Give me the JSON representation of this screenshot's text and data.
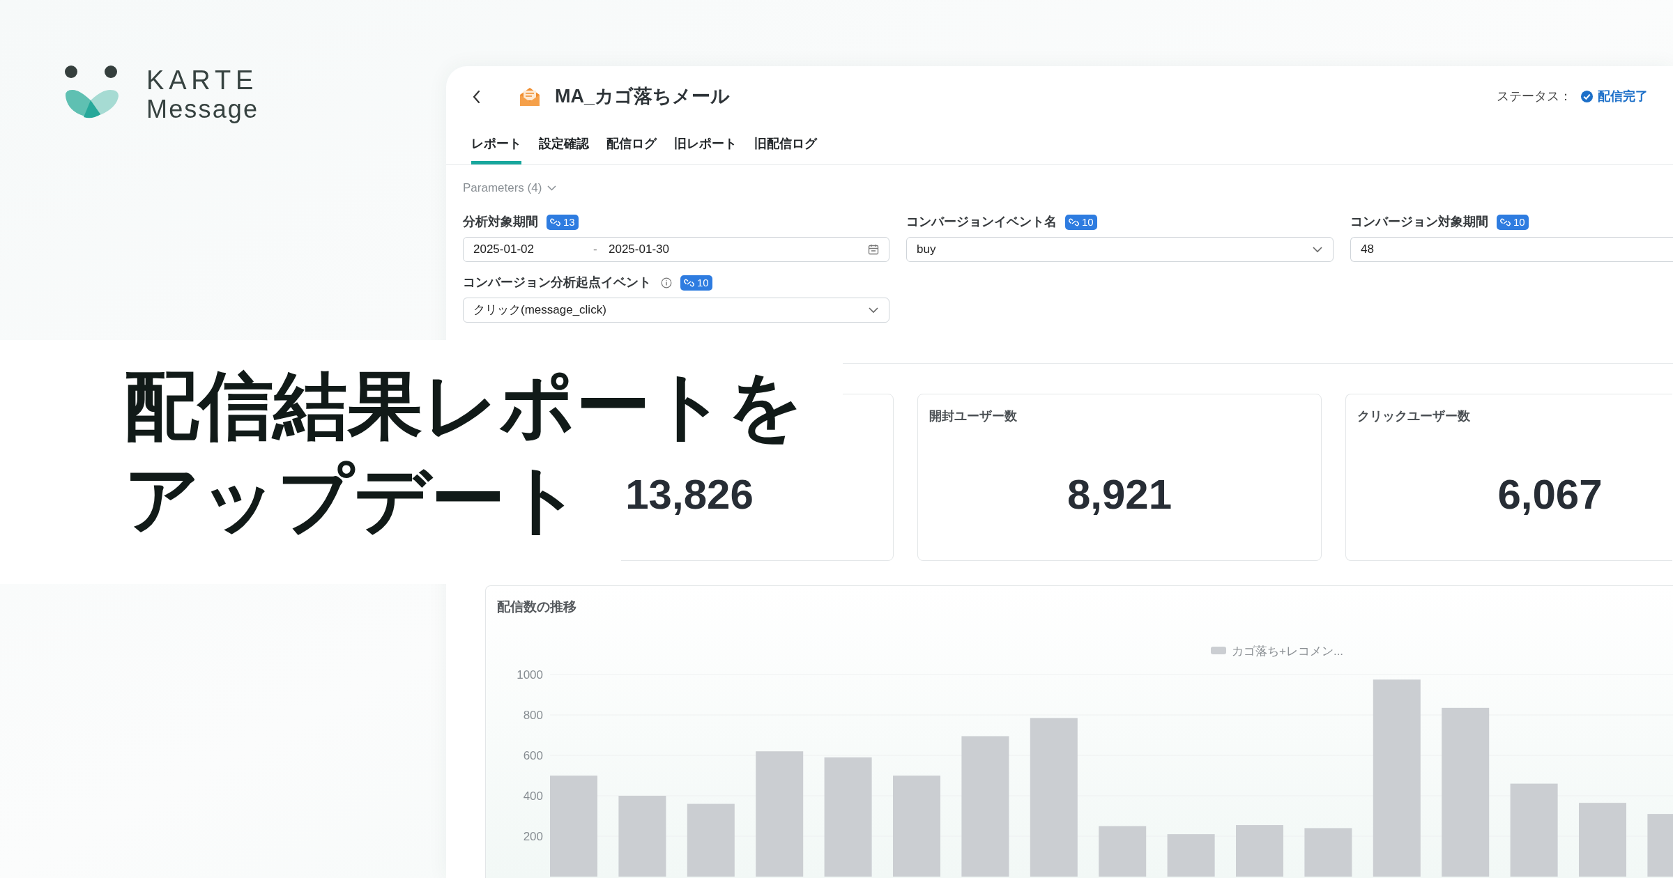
{
  "brand": {
    "name": "KARTE",
    "product": "Message"
  },
  "headline": [
    "配信結果レポートを",
    "アップデート"
  ],
  "app": {
    "title": "MA_カゴ落ちメール",
    "status_label": "ステータス：",
    "status": "配信完了",
    "tabs": [
      {
        "label": "レポート",
        "selected": true
      },
      {
        "label": "設定確認",
        "selected": false
      },
      {
        "label": "配信ログ",
        "selected": false
      },
      {
        "label": "旧レポート",
        "selected": false
      },
      {
        "label": "旧配信ログ",
        "selected": false
      }
    ],
    "parameters_toggle": "Parameters (4)",
    "parameters": [
      {
        "kind": "date_range",
        "label": "分析対象期間",
        "badge": "13",
        "start": "2025-01-02",
        "separator": "-",
        "end": "2025-01-30"
      },
      {
        "kind": "select",
        "label": "コンバージョンイベント名",
        "badge": "10",
        "value": "buy"
      },
      {
        "kind": "text",
        "label": "コンバージョン対象期間",
        "badge": "10",
        "value": "48"
      },
      {
        "kind": "select",
        "label": "コンバージョン分析起点イベント",
        "info": true,
        "badge": "10",
        "value": "クリック(message_click)"
      }
    ],
    "metrics": [
      {
        "value": "13,826"
      },
      {
        "label": "開封ユーザー数",
        "value": "8,921"
      },
      {
        "label": "クリックユーザー数",
        "value": "6,067"
      }
    ],
    "chart": {
      "title": "配信数の推移",
      "chart_data": {
        "type": "bar",
        "ylim": [
          0,
          1000
        ],
        "yticks": [
          200,
          400,
          600,
          800,
          1000
        ],
        "series": [
          {
            "name": "カゴ落ち+レコメン...",
            "color": "#cbced2",
            "values": [
              500,
              400,
              360,
              620,
              590,
              500,
              695,
              785,
              250,
              210,
              255,
              240,
              975,
              835,
              460,
              365,
              310
            ]
          }
        ]
      }
    }
  }
}
